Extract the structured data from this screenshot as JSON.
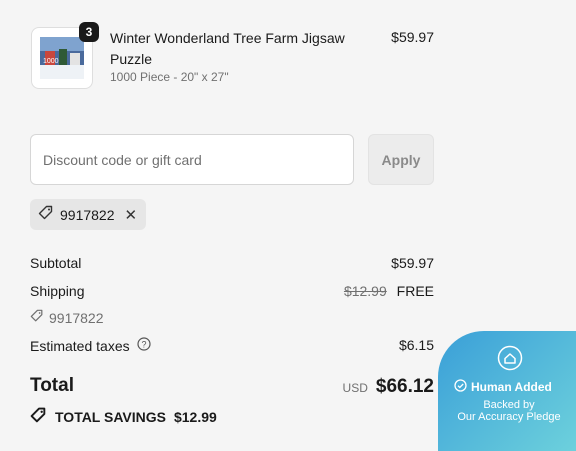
{
  "product": {
    "quantity": "3",
    "title": "Winter Wonderland Tree Farm Jigsaw Puzzle",
    "variant": "1000 Piece - 20\" x 27\"",
    "price": "$59.97",
    "thumbnail_text": "1000"
  },
  "discount": {
    "placeholder": "Discount code or gift card",
    "apply_label": "Apply",
    "applied_code": "9917822"
  },
  "summary": {
    "subtotal_label": "Subtotal",
    "subtotal_value": "$59.97",
    "shipping_label": "Shipping",
    "shipping_original": "$12.99",
    "shipping_value": "FREE",
    "shipping_code": "9917822",
    "taxes_label": "Estimated taxes",
    "taxes_value": "$6.15",
    "total_label": "Total",
    "currency": "USD",
    "total_value": "$66.12",
    "savings_label": "TOTAL SAVINGS",
    "savings_value": "$12.99"
  },
  "pledge": {
    "title": "Human Added",
    "line1": "Backed by",
    "line2": "Our Accuracy Pledge"
  },
  "colors": {
    "badge_gradient_start": "#3a9fd8",
    "badge_gradient_end": "#6fd3dc"
  }
}
